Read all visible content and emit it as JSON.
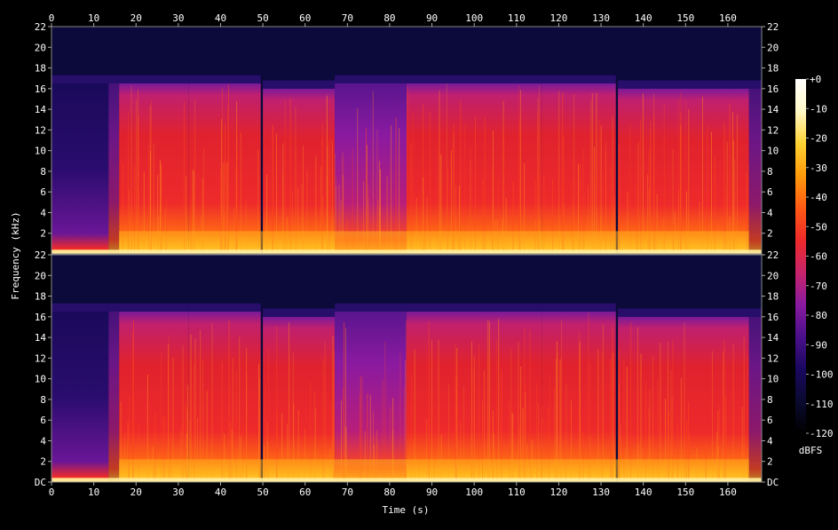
{
  "chart_data": {
    "type": "heatmap",
    "xlabel": "Time (s)",
    "ylabel": "Frequency (kHz)",
    "xlim": [
      0,
      168
    ],
    "x_ticks": [
      "0",
      "10",
      "20",
      "30",
      "40",
      "50",
      "60",
      "70",
      "80",
      "90",
      "100",
      "110",
      "120",
      "130",
      "140",
      "150",
      "160"
    ],
    "channels": [
      {
        "ylim": [
          0,
          22
        ],
        "y_ticks": [
          "22",
          "20",
          "18",
          "16",
          "14",
          "12",
          "10",
          "8",
          "6",
          "4",
          "2"
        ]
      },
      {
        "ylim": [
          0,
          22
        ],
        "y_ticks": [
          "22",
          "20",
          "18",
          "16",
          "14",
          "12",
          "10",
          "8",
          "6",
          "4",
          "2",
          "DC"
        ]
      }
    ],
    "colorbar": {
      "label": "dBFS",
      "range": [
        -120,
        0
      ],
      "ticks": [
        "+0",
        "-10",
        "-20",
        "-30",
        "-40",
        "-50",
        "-60",
        "-70",
        "-80",
        "-90",
        "-100",
        "-110",
        "-120"
      ],
      "stops": [
        "#000000",
        "#0a0a30",
        "#1a0860",
        "#4a0f8a",
        "#8a1aa0",
        "#c8246a",
        "#ee2a2a",
        "#ff5a14",
        "#ff9a0a",
        "#ffd232",
        "#fff8c8",
        "#ffffff"
      ]
    },
    "segments": [
      {
        "start": 0,
        "end": 13.5,
        "energy": "low",
        "cutoff_khz": 16.5
      },
      {
        "start": 13.5,
        "end": 16,
        "energy": "fade-in",
        "cutoff_khz": 16.5
      },
      {
        "start": 16,
        "end": 32.5,
        "energy": "high",
        "cutoff_khz": 16.5
      },
      {
        "start": 32.5,
        "end": 49.5,
        "energy": "high",
        "cutoff_khz": 16.5
      },
      {
        "start": 50,
        "end": 67,
        "energy": "high",
        "cutoff_khz": 16
      },
      {
        "start": 67,
        "end": 84,
        "energy": "mid",
        "cutoff_khz": 16.5
      },
      {
        "start": 84,
        "end": 116,
        "energy": "high",
        "cutoff_khz": 16.5
      },
      {
        "start": 116,
        "end": 133.5,
        "energy": "high",
        "cutoff_khz": 16.5
      },
      {
        "start": 134,
        "end": 165,
        "energy": "high",
        "cutoff_khz": 16
      },
      {
        "start": 165,
        "end": 168,
        "energy": "fade-out",
        "cutoff_khz": 16
      }
    ]
  }
}
